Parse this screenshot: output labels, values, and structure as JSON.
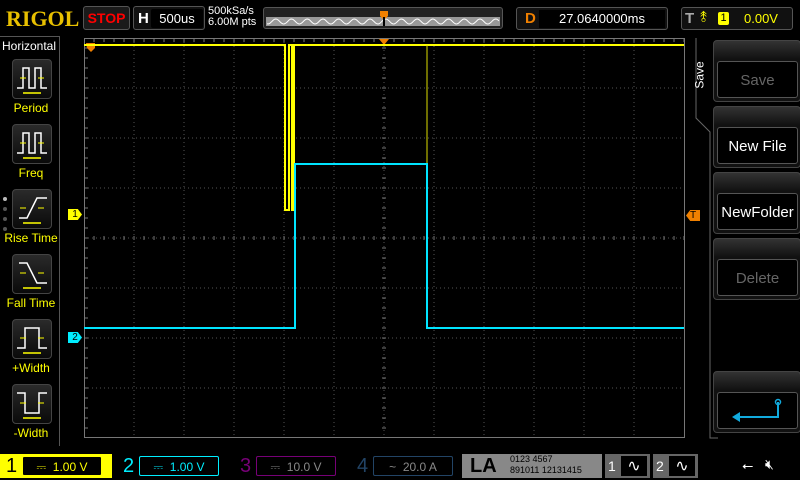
{
  "header": {
    "logo": "RIGOL",
    "run_state": "STOP",
    "timebase_label": "H",
    "timebase": "500us",
    "sample_rate": "500kSa/s",
    "memory_depth": "6.00M pts",
    "delay_label": "D",
    "delay": "27.0640000ms",
    "trigger_label": "T",
    "trigger_source": "1",
    "trigger_level": "0.00V"
  },
  "left_menu": {
    "title": "Horizontal",
    "items": [
      {
        "label": "Period"
      },
      {
        "label": "Freq"
      },
      {
        "label": "Rise Time"
      },
      {
        "label": "Fall Time"
      },
      {
        "label": "+Width"
      },
      {
        "label": "-Width"
      }
    ]
  },
  "right_menu": {
    "title": "Save",
    "items": [
      {
        "label": "Save",
        "enabled": false
      },
      {
        "label": "New File",
        "enabled": true
      },
      {
        "label": "NewFolder",
        "enabled": true
      },
      {
        "label": "Delete",
        "enabled": false
      }
    ]
  },
  "markers": {
    "ch1": "1",
    "ch2": "2",
    "trigger": "T"
  },
  "channels": [
    {
      "num": "1",
      "coupling": "DC",
      "scale": "1.00 V",
      "color": "#ffff00"
    },
    {
      "num": "2",
      "coupling": "DC",
      "scale": "1.00 V",
      "color": "#00e5ff"
    },
    {
      "num": "3",
      "coupling": "DC",
      "scale": "10.0 V",
      "color": "#b000b0"
    },
    {
      "num": "4",
      "coupling": "AC",
      "scale": "20.0 A",
      "color": "#2060c0"
    }
  ],
  "la": {
    "label": "LA",
    "row1": "0123 4567",
    "row2": "891011 12131415"
  },
  "math": [
    "1",
    "2"
  ],
  "colors": {
    "ch1": "#ffff00",
    "ch2": "#00e5ff",
    "trigger": "#f08000"
  }
}
